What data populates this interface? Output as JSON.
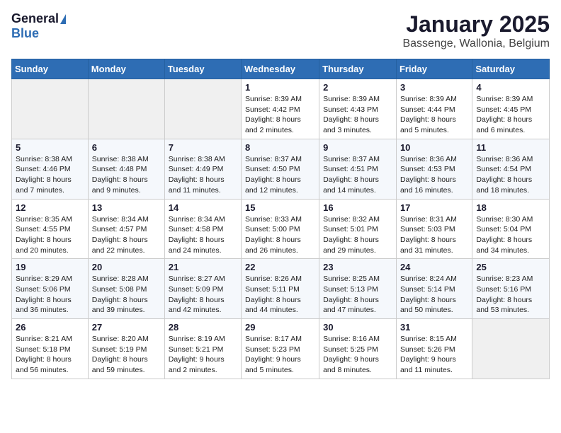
{
  "logo": {
    "general": "General",
    "blue": "Blue"
  },
  "title": "January 2025",
  "subtitle": "Bassenge, Wallonia, Belgium",
  "weekdays": [
    "Sunday",
    "Monday",
    "Tuesday",
    "Wednesday",
    "Thursday",
    "Friday",
    "Saturday"
  ],
  "weeks": [
    [
      {
        "day": "",
        "info": ""
      },
      {
        "day": "",
        "info": ""
      },
      {
        "day": "",
        "info": ""
      },
      {
        "day": "1",
        "info": "Sunrise: 8:39 AM\nSunset: 4:42 PM\nDaylight: 8 hours\nand 2 minutes."
      },
      {
        "day": "2",
        "info": "Sunrise: 8:39 AM\nSunset: 4:43 PM\nDaylight: 8 hours\nand 3 minutes."
      },
      {
        "day": "3",
        "info": "Sunrise: 8:39 AM\nSunset: 4:44 PM\nDaylight: 8 hours\nand 5 minutes."
      },
      {
        "day": "4",
        "info": "Sunrise: 8:39 AM\nSunset: 4:45 PM\nDaylight: 8 hours\nand 6 minutes."
      }
    ],
    [
      {
        "day": "5",
        "info": "Sunrise: 8:38 AM\nSunset: 4:46 PM\nDaylight: 8 hours\nand 7 minutes."
      },
      {
        "day": "6",
        "info": "Sunrise: 8:38 AM\nSunset: 4:48 PM\nDaylight: 8 hours\nand 9 minutes."
      },
      {
        "day": "7",
        "info": "Sunrise: 8:38 AM\nSunset: 4:49 PM\nDaylight: 8 hours\nand 11 minutes."
      },
      {
        "day": "8",
        "info": "Sunrise: 8:37 AM\nSunset: 4:50 PM\nDaylight: 8 hours\nand 12 minutes."
      },
      {
        "day": "9",
        "info": "Sunrise: 8:37 AM\nSunset: 4:51 PM\nDaylight: 8 hours\nand 14 minutes."
      },
      {
        "day": "10",
        "info": "Sunrise: 8:36 AM\nSunset: 4:53 PM\nDaylight: 8 hours\nand 16 minutes."
      },
      {
        "day": "11",
        "info": "Sunrise: 8:36 AM\nSunset: 4:54 PM\nDaylight: 8 hours\nand 18 minutes."
      }
    ],
    [
      {
        "day": "12",
        "info": "Sunrise: 8:35 AM\nSunset: 4:55 PM\nDaylight: 8 hours\nand 20 minutes."
      },
      {
        "day": "13",
        "info": "Sunrise: 8:34 AM\nSunset: 4:57 PM\nDaylight: 8 hours\nand 22 minutes."
      },
      {
        "day": "14",
        "info": "Sunrise: 8:34 AM\nSunset: 4:58 PM\nDaylight: 8 hours\nand 24 minutes."
      },
      {
        "day": "15",
        "info": "Sunrise: 8:33 AM\nSunset: 5:00 PM\nDaylight: 8 hours\nand 26 minutes."
      },
      {
        "day": "16",
        "info": "Sunrise: 8:32 AM\nSunset: 5:01 PM\nDaylight: 8 hours\nand 29 minutes."
      },
      {
        "day": "17",
        "info": "Sunrise: 8:31 AM\nSunset: 5:03 PM\nDaylight: 8 hours\nand 31 minutes."
      },
      {
        "day": "18",
        "info": "Sunrise: 8:30 AM\nSunset: 5:04 PM\nDaylight: 8 hours\nand 34 minutes."
      }
    ],
    [
      {
        "day": "19",
        "info": "Sunrise: 8:29 AM\nSunset: 5:06 PM\nDaylight: 8 hours\nand 36 minutes."
      },
      {
        "day": "20",
        "info": "Sunrise: 8:28 AM\nSunset: 5:08 PM\nDaylight: 8 hours\nand 39 minutes."
      },
      {
        "day": "21",
        "info": "Sunrise: 8:27 AM\nSunset: 5:09 PM\nDaylight: 8 hours\nand 42 minutes."
      },
      {
        "day": "22",
        "info": "Sunrise: 8:26 AM\nSunset: 5:11 PM\nDaylight: 8 hours\nand 44 minutes."
      },
      {
        "day": "23",
        "info": "Sunrise: 8:25 AM\nSunset: 5:13 PM\nDaylight: 8 hours\nand 47 minutes."
      },
      {
        "day": "24",
        "info": "Sunrise: 8:24 AM\nSunset: 5:14 PM\nDaylight: 8 hours\nand 50 minutes."
      },
      {
        "day": "25",
        "info": "Sunrise: 8:23 AM\nSunset: 5:16 PM\nDaylight: 8 hours\nand 53 minutes."
      }
    ],
    [
      {
        "day": "26",
        "info": "Sunrise: 8:21 AM\nSunset: 5:18 PM\nDaylight: 8 hours\nand 56 minutes."
      },
      {
        "day": "27",
        "info": "Sunrise: 8:20 AM\nSunset: 5:19 PM\nDaylight: 8 hours\nand 59 minutes."
      },
      {
        "day": "28",
        "info": "Sunrise: 8:19 AM\nSunset: 5:21 PM\nDaylight: 9 hours\nand 2 minutes."
      },
      {
        "day": "29",
        "info": "Sunrise: 8:17 AM\nSunset: 5:23 PM\nDaylight: 9 hours\nand 5 minutes."
      },
      {
        "day": "30",
        "info": "Sunrise: 8:16 AM\nSunset: 5:25 PM\nDaylight: 9 hours\nand 8 minutes."
      },
      {
        "day": "31",
        "info": "Sunrise: 8:15 AM\nSunset: 5:26 PM\nDaylight: 9 hours\nand 11 minutes."
      },
      {
        "day": "",
        "info": ""
      }
    ]
  ]
}
